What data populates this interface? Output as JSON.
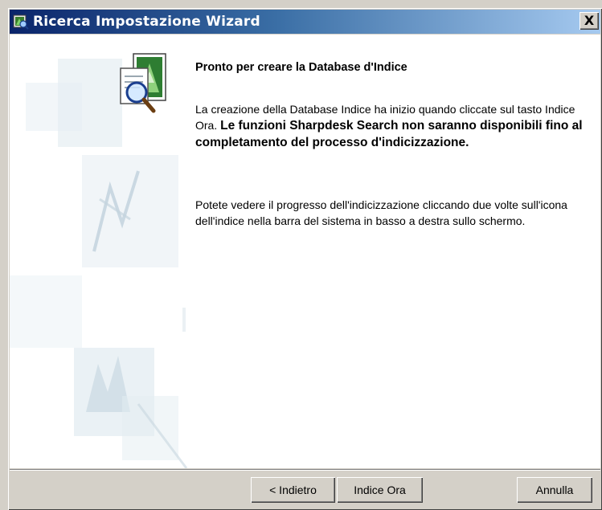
{
  "window": {
    "title": "Ricerca Impostazione Wizard",
    "close_glyph": "X",
    "title_icon": "wizard-window-icon"
  },
  "content": {
    "heading": "Pronto per creare la Database d'Indice",
    "paragraph1_plain": "La creazione della Database Indice ha inizio quando cliccate sul tasto Indice Ora.",
    "paragraph1_bold": "Le funzioni Sharpdesk Search non saranno disponibili fino al completamento del processo d'indicizzazione.",
    "paragraph2": "Potete vedere il progresso dell'indicizzazione cliccando due volte sull'icona dell'indice nella barra del sistema in basso a destra sullo schermo.",
    "icons": {
      "wizard": "document-magnifier-icon",
      "watermark": "faded-graphics-watermark"
    }
  },
  "buttons": {
    "back_label": "< Indietro",
    "index_label": "Indice Ora",
    "cancel_label": "Annulla"
  },
  "colors": {
    "titlebar_start": "#0a246a",
    "titlebar_end": "#a6caf0",
    "dialog_face": "#d4d0c8",
    "content_bg": "#ffffff"
  }
}
